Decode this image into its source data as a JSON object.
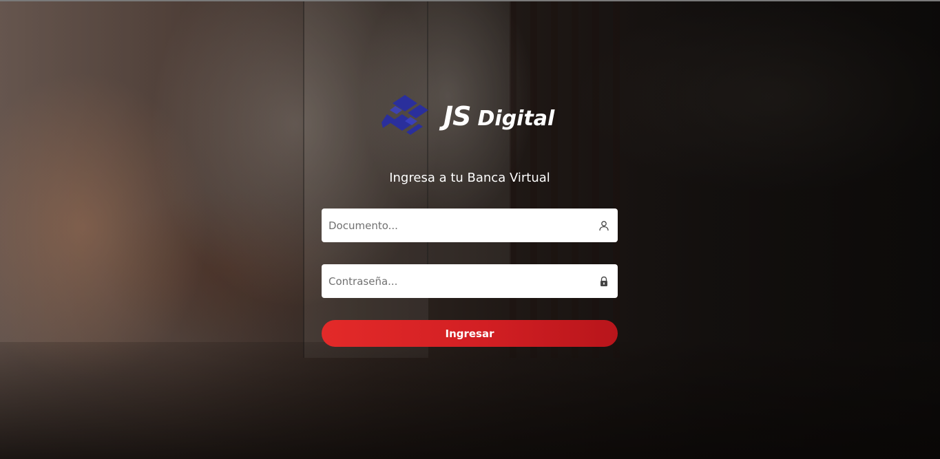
{
  "brand": {
    "name_primary": "JS",
    "name_secondary": "Digital",
    "logo_color": "#2a2f9c"
  },
  "login": {
    "subtitle": "Ingresa a tu Banca Virtual",
    "document_placeholder": "Documento...",
    "password_placeholder": "Contraseña...",
    "submit_label": "Ingresar",
    "document_icon": "user-icon",
    "password_icon": "lock-icon"
  },
  "colors": {
    "button": "#e32a29",
    "text": "#ffffff"
  }
}
